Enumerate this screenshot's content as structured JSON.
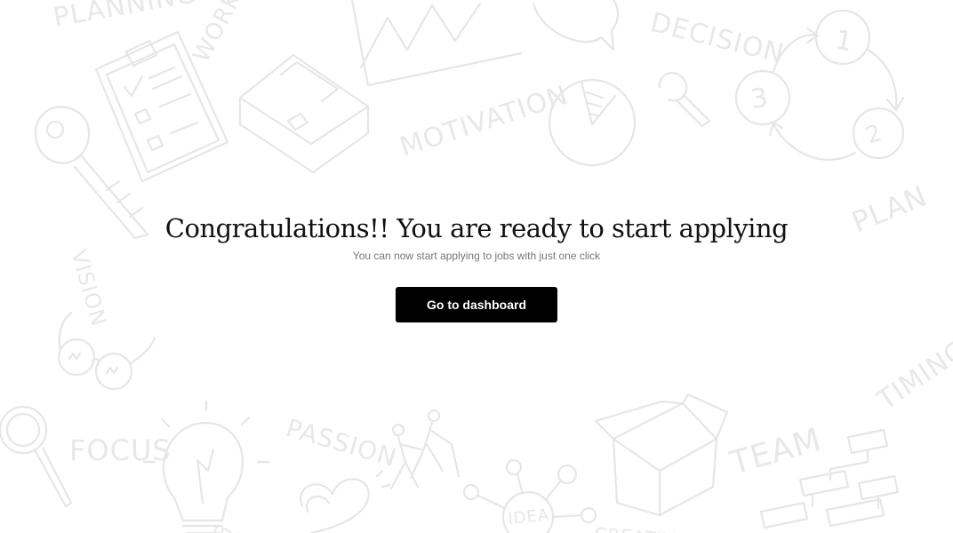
{
  "background": {
    "doodle_color": "#e6e6e6",
    "words": {
      "planning": "PLANNING",
      "work": "WORK",
      "decision": "DECISION",
      "motivation": "MOTIVATION",
      "plan": "PLAN",
      "vision": "VISION",
      "focus": "FOCUS",
      "passion": "PASSION",
      "timing": "TIMING",
      "team": "TEAM",
      "idea": "IDEA",
      "idea_bulb": "IDEA",
      "creativity": "CREATIVITY"
    },
    "cycle_numbers": [
      "1",
      "2",
      "3"
    ]
  },
  "headline": "Congratulations!! You are ready to start applying",
  "subheadline": "You can now start applying to jobs with just one click",
  "cta": {
    "label": "Go to dashboard",
    "background": "#000000",
    "text_color": "#ffffff"
  }
}
